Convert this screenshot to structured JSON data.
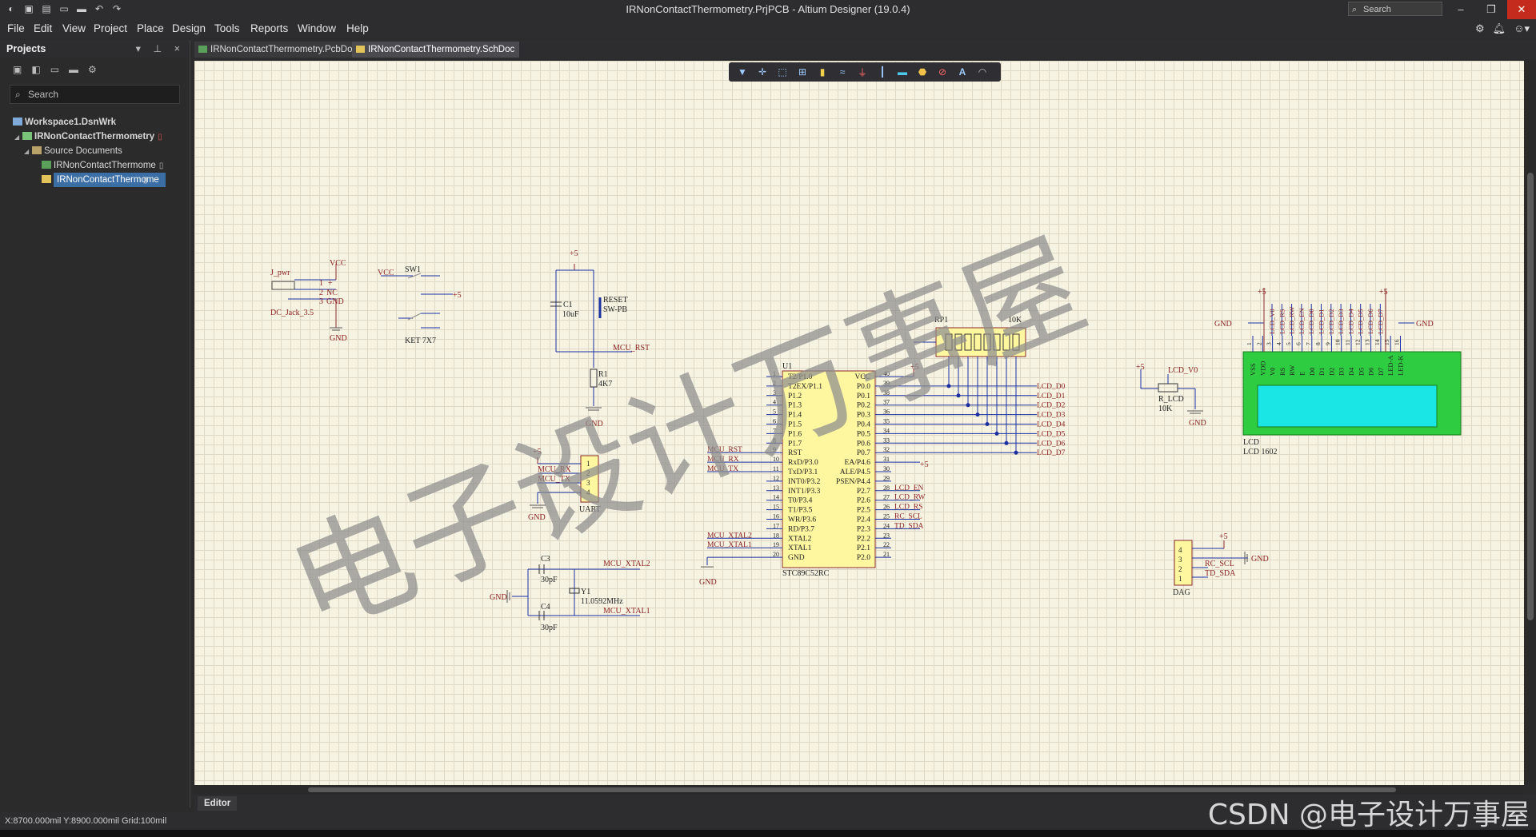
{
  "window": {
    "title": "IRNonContactThermometry.PrjPCB - Altium Designer (19.0.4)",
    "search_placeholder": "Search"
  },
  "menu": [
    "File",
    "Edit",
    "View",
    "Project",
    "Place",
    "Design",
    "Tools",
    "Reports",
    "Window",
    "Help"
  ],
  "panel": {
    "title": "Projects",
    "search_placeholder": "Search",
    "tree": {
      "workspace": "Workspace1.DsnWrk",
      "project": "IRNonContactThermometry",
      "folder": "Source Documents",
      "doc1": "IRNonContactThermome",
      "doc2": "IRNonContactThermome"
    }
  },
  "tabs": {
    "pcb": "IRNonContactThermometry.PcbDoc",
    "sch": "IRNonContactThermometry.SchDoc"
  },
  "editor_tab": "Editor",
  "status": "X:8700.000mil Y:8900.000mil     Grid:100mil",
  "overlay_text": "CSDN @电子设计万事屋",
  "schematic": {
    "power": {
      "jack_ref": "J_pwr",
      "jack_val": "DC_Jack_3.5",
      "vcc": "VCC",
      "gnd": "GND",
      "p1": "1",
      "p2": "2",
      "p3": "3",
      "plus": "+",
      "nc": "NC",
      "gnd_pin": "GND",
      "sw_ref": "SW1",
      "sw_val": "KET 7X7",
      "plus5": "+5"
    },
    "reset": {
      "c1": "C1",
      "c1v": "10uF",
      "btn": "RESET",
      "btn_val": "SW-PB",
      "net": "MCU_RST",
      "r1": "R1",
      "r1v": "4K7"
    },
    "uart": {
      "ref": "UART",
      "rx": "MCU_RX",
      "tx": "MCU_TX"
    },
    "osc": {
      "c3": "C3",
      "c3v": "30pF",
      "c4": "C4",
      "c4v": "30pF",
      "y1": "Y1",
      "y1v": "11.0592MHz",
      "x2": "MCU_XTAL2",
      "x1": "MCU_XTAL1"
    },
    "mcu": {
      "ref": "U1",
      "val": "STC89C52RC",
      "left_pins": [
        "T2/P1.0",
        "T2EX/P1.1",
        "P1.2",
        "P1.3",
        "P1.4",
        "P1.5",
        "P1.6",
        "P1.7",
        "RST",
        "RxD/P3.0",
        "TxD/P3.1",
        "INT0/P3.2",
        "INT1/P3.3",
        "T0/P3.4",
        "T1/P3.5",
        "WR/P3.6",
        "RD/P3.7",
        "XTAL2",
        "XTAL1",
        "GND"
      ],
      "right_pins": [
        "VCC",
        "P0.0",
        "P0.1",
        "P0.2",
        "P0.3",
        "P0.4",
        "P0.5",
        "P0.6",
        "P0.7",
        "EA/P4.6",
        "ALE/P4.5",
        "PSEN/P4.4",
        "P2.7",
        "P2.6",
        "P2.5",
        "P2.4",
        "P2.3",
        "P2.2",
        "P2.1",
        "P2.0"
      ],
      "left_nets": [
        "MCU_RST",
        "MCU_RX",
        "MCU_TX",
        "MCU_XTAL2",
        "MCU_XTAL1"
      ],
      "right_nets": [
        "LCD_D0",
        "LCD_D1",
        "LCD_D2",
        "LCD_D3",
        "LCD_D4",
        "LCD_D5",
        "LCD_D6",
        "LCD_D7",
        "LCD_EN",
        "LCD_RW",
        "LCD_RS",
        "RC_SCL",
        "TD_SDA"
      ]
    },
    "rp1": {
      "ref": "RP1",
      "val": "10K"
    },
    "rlcd": {
      "ref": "R_LCD",
      "val": "10K",
      "net": "LCD_V0"
    },
    "lcd": {
      "ref": "LCD",
      "val": "LCD 1602",
      "pins": [
        "VSS",
        "VDD",
        "V0",
        "RS",
        "RW",
        "E",
        "D0",
        "D1",
        "D2",
        "D3",
        "D4",
        "D5",
        "D6",
        "D7",
        "LED-A",
        "LED-K"
      ],
      "nets": [
        "LCD_V0",
        "LCD_RS",
        "LCD_RW",
        "LCD_EN",
        "LCD_D0",
        "LCD_D1",
        "LCD_D2",
        "LCD_D3",
        "LCD_D4",
        "LCD_D5",
        "LCD_D6",
        "LCD_D7"
      ]
    },
    "dag": {
      "ref": "DAG",
      "scl": "RC_SCL",
      "sda": "TD_SDA"
    },
    "watermark": "电子设计万事屋"
  }
}
